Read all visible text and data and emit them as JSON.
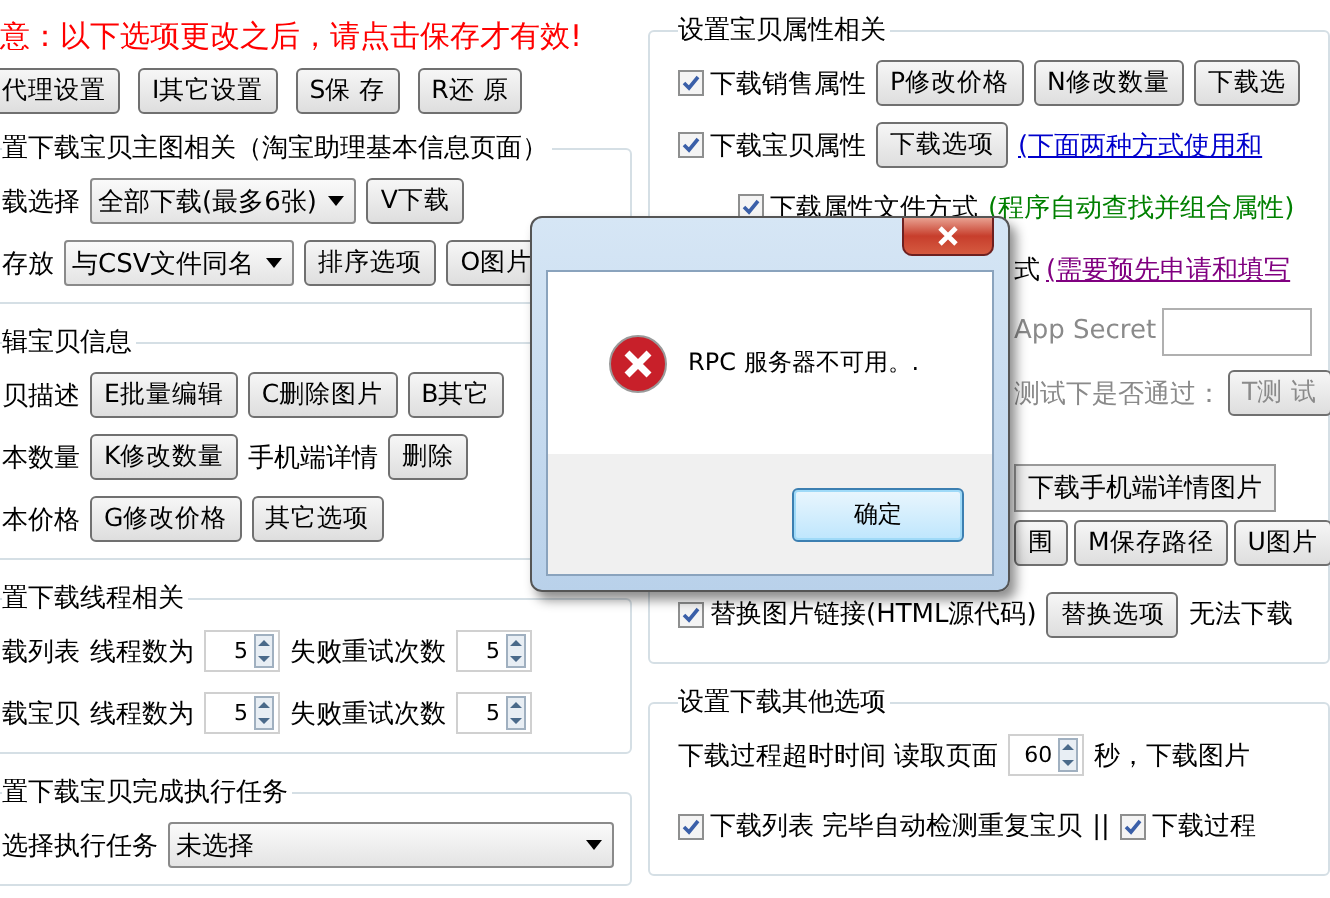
{
  "notice": "意：以下选项更改之后，请点击保存才有效!",
  "top_buttons": [
    "代理设置",
    "I其它设置",
    "S保 存",
    "R还 原"
  ],
  "left_groups": [
    {
      "title": "置下载宝贝主图相关（淘宝助理基本信息页面）",
      "rows": [
        {
          "items": [
            {
              "kind": "label",
              "text": "载选择"
            },
            {
              "kind": "select",
              "value": "全部下载(最多6张)"
            },
            {
              "kind": "button",
              "text": "V下载"
            }
          ]
        },
        {
          "items": [
            {
              "kind": "label",
              "text": "存放"
            },
            {
              "kind": "select",
              "value": "与CSV文件同名"
            },
            {
              "kind": "button",
              "text": "排序选项"
            },
            {
              "kind": "button",
              "text": "O图片"
            }
          ]
        }
      ]
    },
    {
      "title": "辑宝贝信息",
      "rows": [
        {
          "items": [
            {
              "kind": "label",
              "text": "贝描述"
            },
            {
              "kind": "button",
              "text": "E批量编辑"
            },
            {
              "kind": "button",
              "text": "C删除图片"
            },
            {
              "kind": "button",
              "text": "B其它"
            }
          ]
        },
        {
          "items": [
            {
              "kind": "label",
              "text": "本数量"
            },
            {
              "kind": "button",
              "text": "K修改数量"
            },
            {
              "kind": "label",
              "text": "手机端详情"
            },
            {
              "kind": "button",
              "text": "删除"
            }
          ]
        },
        {
          "items": [
            {
              "kind": "label",
              "text": "本价格"
            },
            {
              "kind": "button",
              "text": "G修改价格"
            },
            {
              "kind": "button",
              "text": "其它选项"
            }
          ]
        }
      ]
    },
    {
      "title": "置下载线程相关",
      "rows": [
        {
          "items": [
            {
              "kind": "label",
              "text": "载列表"
            },
            {
              "kind": "label",
              "text": "线程数为"
            },
            {
              "kind": "spin",
              "value": "5"
            },
            {
              "kind": "label",
              "text": "失败重试次数"
            },
            {
              "kind": "spin",
              "value": "5"
            }
          ]
        },
        {
          "items": [
            {
              "kind": "label",
              "text": "载宝贝"
            },
            {
              "kind": "label",
              "text": "线程数为"
            },
            {
              "kind": "spin",
              "value": "5"
            },
            {
              "kind": "label",
              "text": "失败重试次数"
            },
            {
              "kind": "spin",
              "value": "5"
            }
          ]
        }
      ]
    },
    {
      "title": "置下载宝贝完成执行任务",
      "rows": [
        {
          "items": [
            {
              "kind": "label",
              "text": "选择执行任务"
            },
            {
              "kind": "select",
              "value": "未选择"
            }
          ]
        }
      ]
    }
  ],
  "right_groups": [
    {
      "title": "设置宝贝属性相关",
      "rows": [
        {
          "items": [
            {
              "kind": "checkbox",
              "text": "下载销售属性",
              "checked": true
            },
            {
              "kind": "button",
              "text": "P修改价格"
            },
            {
              "kind": "button",
              "text": "N修改数量"
            },
            {
              "kind": "button",
              "text": "下载选"
            }
          ]
        },
        {
          "items": [
            {
              "kind": "checkbox",
              "text": "下载宝贝属性",
              "checked": true
            },
            {
              "kind": "button",
              "text": "下载选项"
            },
            {
              "kind": "link",
              "text": "(下面两种方式使用和",
              "visited": false
            }
          ]
        },
        {
          "indent": true,
          "items": [
            {
              "kind": "checkbox",
              "text": "下载属性文件方式",
              "checked": true
            },
            {
              "kind": "note",
              "text": "(程序自动查找并组合属性)"
            }
          ]
        },
        {
          "partly_hidden": true,
          "items": [
            {
              "kind": "label",
              "text": "式"
            },
            {
              "kind": "link",
              "text": "(需要预先申请和填写",
              "visited": true
            }
          ]
        },
        {
          "partly_hidden": true,
          "items": [
            {
              "kind": "hint",
              "text": "App Secret"
            },
            {
              "kind": "field"
            }
          ]
        },
        {
          "partly_hidden": true,
          "items": [
            {
              "kind": "hint",
              "text": "测试下是否通过："
            },
            {
              "kind": "button",
              "text": "T测 试",
              "disabled": true
            }
          ]
        },
        {
          "partly_hidden": true,
          "items": [
            {
              "kind": "tab",
              "text": "下载手机端详情图片",
              "selected": false
            }
          ]
        },
        {
          "partly_hidden": true,
          "items": [
            {
              "kind": "button",
              "text": "围"
            },
            {
              "kind": "button",
              "text": "M保存路径"
            },
            {
              "kind": "button",
              "text": "U图片"
            }
          ]
        },
        {
          "items": [
            {
              "kind": "checkbox",
              "text": "替换图片链接(HTML源代码)",
              "checked": true
            },
            {
              "kind": "button",
              "text": "替换选项"
            },
            {
              "kind": "label",
              "text": "无法下载"
            }
          ]
        }
      ]
    },
    {
      "title": "设置下载其他选项",
      "rows": [
        {
          "items": [
            {
              "kind": "label",
              "text": "下载过程超时时间 读取页面"
            },
            {
              "kind": "spin",
              "value": "60"
            },
            {
              "kind": "label",
              "text": "秒，下载图片"
            }
          ]
        },
        {
          "items": [
            {
              "kind": "checkbox",
              "text": "下载列表 完毕自动检测重复宝贝",
              "checked": true
            },
            {
              "kind": "label",
              "text": "||"
            },
            {
              "kind": "checkbox",
              "text": "下载过程",
              "checked": true
            }
          ]
        }
      ]
    }
  ],
  "dialog": {
    "message": "RPC 服务器不可用。.",
    "ok_button": "确定"
  }
}
